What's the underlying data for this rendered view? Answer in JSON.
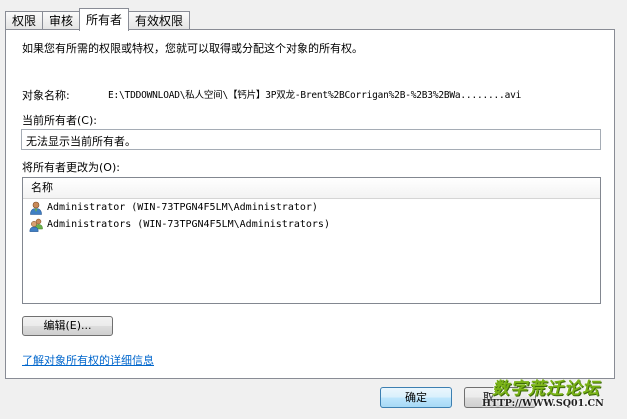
{
  "tabs": [
    {
      "label": "权限"
    },
    {
      "label": "审核"
    },
    {
      "label": "所有者"
    },
    {
      "label": "有效权限"
    }
  ],
  "active_tab": "所有者",
  "intro_text": "如果您有所需的权限或特权，您就可以取得或分配这个对象的所有权。",
  "object": {
    "label": "对象名称:",
    "value": "E:\\TDDOWNLOAD\\私人空间\\【钙片】3P双龙-Brent%2BCorrigan%2B-%2B3%2BWa........avi"
  },
  "current_owner": {
    "label": "当前所有者(C):",
    "value": "无法显示当前所有者。"
  },
  "change_owner": {
    "label": "将所有者更改为(O):",
    "column_header": "名称",
    "items": [
      {
        "name": "Administrator (WIN-73TPGN4F5LM\\Administrator)",
        "icon": "user-icon"
      },
      {
        "name": "Administrators (WIN-73TPGN4F5LM\\Administrators)",
        "icon": "user-group-icon"
      }
    ]
  },
  "edit_button": "编辑(E)...",
  "learn_link": "了解对象所有权的详细信息",
  "ok_button": "确定",
  "cancel_button": "取",
  "watermark": {
    "title": "数字荒迁论坛",
    "url": "HTTP://WWW.SQ01.CN"
  }
}
